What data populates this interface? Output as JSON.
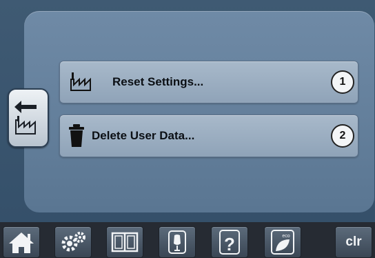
{
  "menu": {
    "items": [
      {
        "label": "Reset Settings...",
        "badge": "1",
        "icon": "factory-icon"
      },
      {
        "label": "Delete User Data...",
        "badge": "2",
        "icon": "trash-icon"
      }
    ]
  },
  "back": {
    "icon": "back-factory-icon"
  },
  "taskbar": {
    "home_icon": "home-icon",
    "settings_icon": "gears-icon",
    "manual_icon": "book-icon",
    "tutorial_icon": "dress-form-icon",
    "help_label": "?",
    "eco_label": "eco",
    "clear_label": "clr"
  },
  "colors": {
    "panel": "#6f8aa6",
    "button": "#a8b9ca",
    "taskbar": "#262b33"
  }
}
